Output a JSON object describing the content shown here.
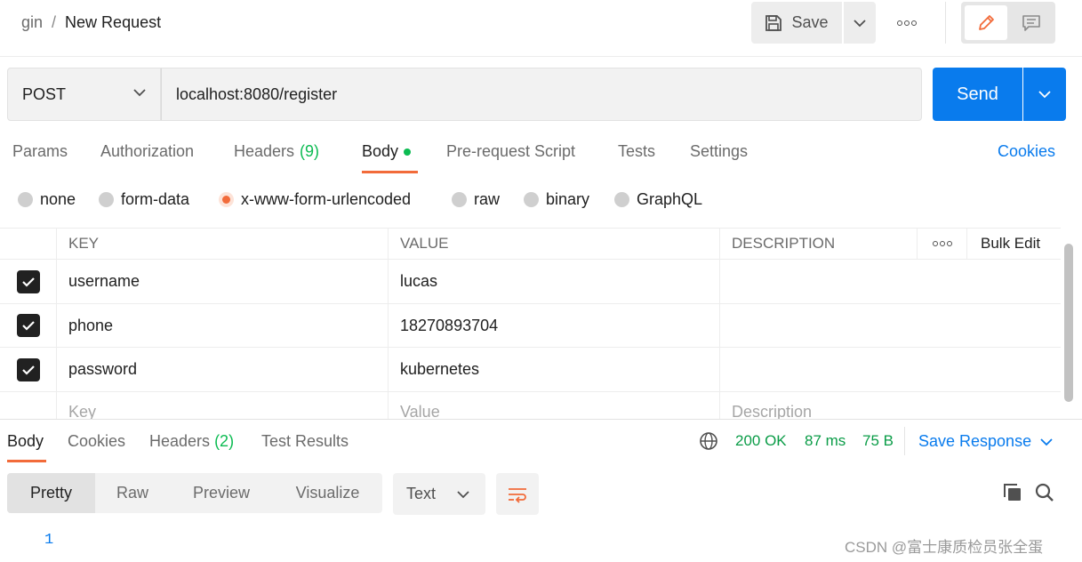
{
  "breadcrumb": {
    "parent": "gin",
    "separator": "/",
    "title": "New Request"
  },
  "toolbar": {
    "save_label": "Save",
    "more_icon": "ellipsis-icon",
    "edit_icon": "pencil-icon",
    "comment_icon": "comment-icon"
  },
  "request": {
    "method": "POST",
    "url": "localhost:8080/register",
    "send_label": "Send"
  },
  "tabs": [
    {
      "label": "Params"
    },
    {
      "label": "Authorization"
    },
    {
      "label": "Headers",
      "count": "(9)"
    },
    {
      "label": "Body",
      "active": true
    },
    {
      "label": "Pre-request Script"
    },
    {
      "label": "Tests"
    },
    {
      "label": "Settings"
    }
  ],
  "cookies_label": "Cookies",
  "body_types": [
    {
      "label": "none"
    },
    {
      "label": "form-data"
    },
    {
      "label": "x-www-form-urlencoded",
      "selected": true
    },
    {
      "label": "raw"
    },
    {
      "label": "binary"
    },
    {
      "label": "GraphQL"
    }
  ],
  "params_table": {
    "headers": {
      "key": "KEY",
      "value": "VALUE",
      "description": "DESCRIPTION",
      "bulk_edit": "Bulk Edit"
    },
    "rows": [
      {
        "checked": true,
        "key": "username",
        "value": "lucas",
        "description": ""
      },
      {
        "checked": true,
        "key": "phone",
        "value": "18270893704",
        "description": ""
      },
      {
        "checked": true,
        "key": "password",
        "value": "kubernetes",
        "description": ""
      }
    ],
    "placeholders": {
      "key": "Key",
      "value": "Value",
      "description": "Description"
    }
  },
  "response": {
    "tabs": [
      {
        "label": "Body",
        "active": true
      },
      {
        "label": "Cookies"
      },
      {
        "label": "Headers",
        "count": "(2)"
      },
      {
        "label": "Test Results"
      }
    ],
    "status": "200 OK",
    "time": "87 ms",
    "size": "75 B",
    "save_label": "Save Response",
    "views": [
      "Pretty",
      "Raw",
      "Preview",
      "Visualize"
    ],
    "format": "Text",
    "line_number": "1"
  },
  "watermark": "CSDN @富士康质检员张全蛋",
  "colors": {
    "accent": "#f26b3a",
    "primary": "#097bed",
    "success": "#0cbb52"
  }
}
